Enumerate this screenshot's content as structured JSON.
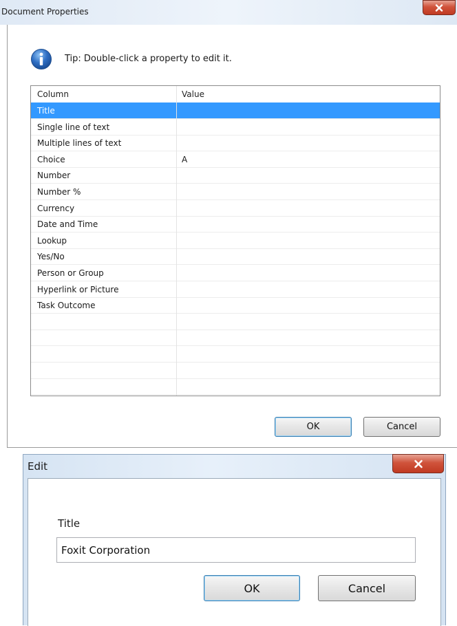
{
  "doc_props": {
    "title": "Document Properties",
    "tip": "Tip: Double-click a property to edit it.",
    "columns": {
      "name": "Column",
      "value": "Value"
    },
    "rows": [
      {
        "name": "Title",
        "value": ""
      },
      {
        "name": "Single line of text",
        "value": ""
      },
      {
        "name": "Multiple lines of text",
        "value": ""
      },
      {
        "name": "Choice",
        "value": "A"
      },
      {
        "name": "Number",
        "value": ""
      },
      {
        "name": "Number %",
        "value": ""
      },
      {
        "name": "Currency",
        "value": ""
      },
      {
        "name": "Date and Time",
        "value": ""
      },
      {
        "name": "Lookup",
        "value": ""
      },
      {
        "name": "Yes/No",
        "value": ""
      },
      {
        "name": "Person or Group",
        "value": ""
      },
      {
        "name": "Hyperlink or Picture",
        "value": ""
      },
      {
        "name": "Task Outcome",
        "value": ""
      }
    ],
    "selected_row": "Title",
    "ok_label": "OK",
    "cancel_label": "Cancel"
  },
  "edit_dialog": {
    "title": "Edit",
    "field_label": "Title",
    "field_value": "Foxit Corporation",
    "ok_label": "OK",
    "cancel_label": "Cancel"
  },
  "colors": {
    "selection": "#3399ff",
    "info_icon": "#2f6fc4",
    "close_button": "#c8452c",
    "default_button_border": "#3c7fb1"
  },
  "icons": {
    "tip": "info-icon",
    "close": "close-icon"
  }
}
